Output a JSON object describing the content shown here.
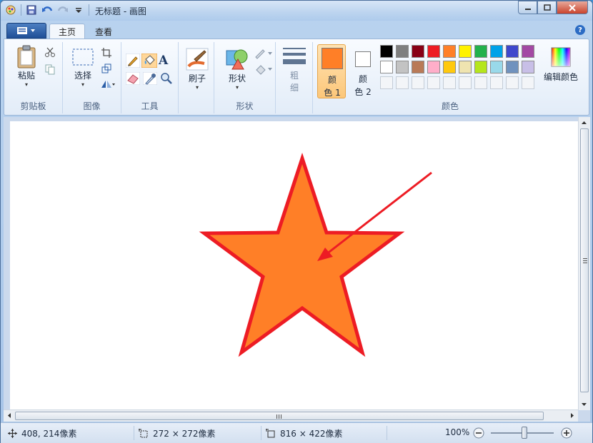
{
  "window": {
    "title": "无标题 - 画图"
  },
  "tabs": {
    "home": "主页",
    "view": "查看"
  },
  "clipboard": {
    "paste": "粘贴",
    "group": "剪贴板"
  },
  "image": {
    "select": "选择",
    "group": "图像"
  },
  "tools": {
    "group": "工具",
    "text_tool": "A"
  },
  "brushes": {
    "label": "刷子"
  },
  "shapes": {
    "label": "形状",
    "group": "形状"
  },
  "size": {
    "line1": "粗",
    "line2": "细"
  },
  "colors": {
    "color1_line1": "颜",
    "color1_line2": "色 1",
    "color2_line1": "颜",
    "color2_line2": "色 2",
    "edit": "编辑颜色",
    "group": "颜色",
    "color1": "#ff7f27",
    "color2": "#ffffff",
    "palette_row1": [
      "#000000",
      "#7f7f7f",
      "#880015",
      "#ed1c24",
      "#ff7f27",
      "#fff200",
      "#22b14c",
      "#00a2e8",
      "#3f48cc",
      "#a349a4"
    ],
    "palette_row2": [
      "#ffffff",
      "#c3c3c3",
      "#b97a57",
      "#ffaec9",
      "#ffc90e",
      "#efe4b0",
      "#b5e61d",
      "#99d9ea",
      "#7092be",
      "#c8bfe7"
    ]
  },
  "drawing": {
    "star_fill": "#ff7f27",
    "star_stroke": "#ed1c24",
    "arrow_color": "#ed1c24"
  },
  "status": {
    "cursor_pos": "408, 214像素",
    "selection_size": "272 × 272像素",
    "canvas_size": "816 × 422像素",
    "zoom": "100%"
  }
}
